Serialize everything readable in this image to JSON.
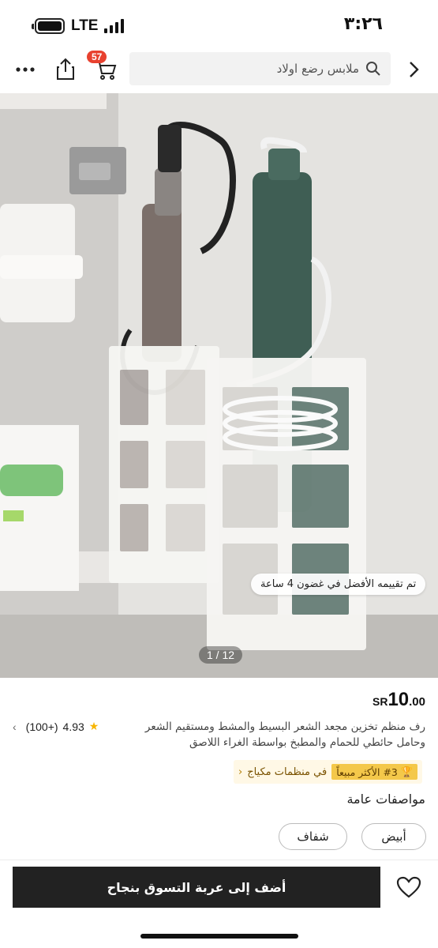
{
  "status_bar": {
    "network": "LTE",
    "time": "٣:٢٦"
  },
  "top_bar": {
    "cart_count": "57",
    "search_placeholder": "ملابس رضع اولاد",
    "icons": [
      "more-icon",
      "share-icon",
      "cart-icon",
      "search-icon",
      "chevron-right-icon"
    ]
  },
  "gallery": {
    "pager": "1 / 12",
    "rank_overlay": "تم تقييمه الأفضل في غضون 4 ساعة"
  },
  "product": {
    "price_currency": "SR",
    "price_integer": "10",
    "price_decimal": ".00",
    "title": "رف منظم تخزين مجعد الشعر البسيط والمشط ومستقيم الشعر وحامل حائطي للحمام والمطبخ بواسطة الغراء اللاصق",
    "rating_value": "4.93",
    "rating_count": "(100+)",
    "rank_badge": "#3 الأكثر مبيعاً",
    "rank_category": "في منظمات مكياج"
  },
  "specs": {
    "title": "مواصفات عامة",
    "options": [
      "أبيض",
      "شفاف"
    ]
  },
  "bottom_bar": {
    "add_to_cart_label": "أضف إلى عربة التسوق بنجاح"
  },
  "colors": {
    "badge_red": "#e8412f",
    "star_gold": "#f7b500",
    "rank_gold": "#f4c84a",
    "cta_dark": "#222222"
  }
}
